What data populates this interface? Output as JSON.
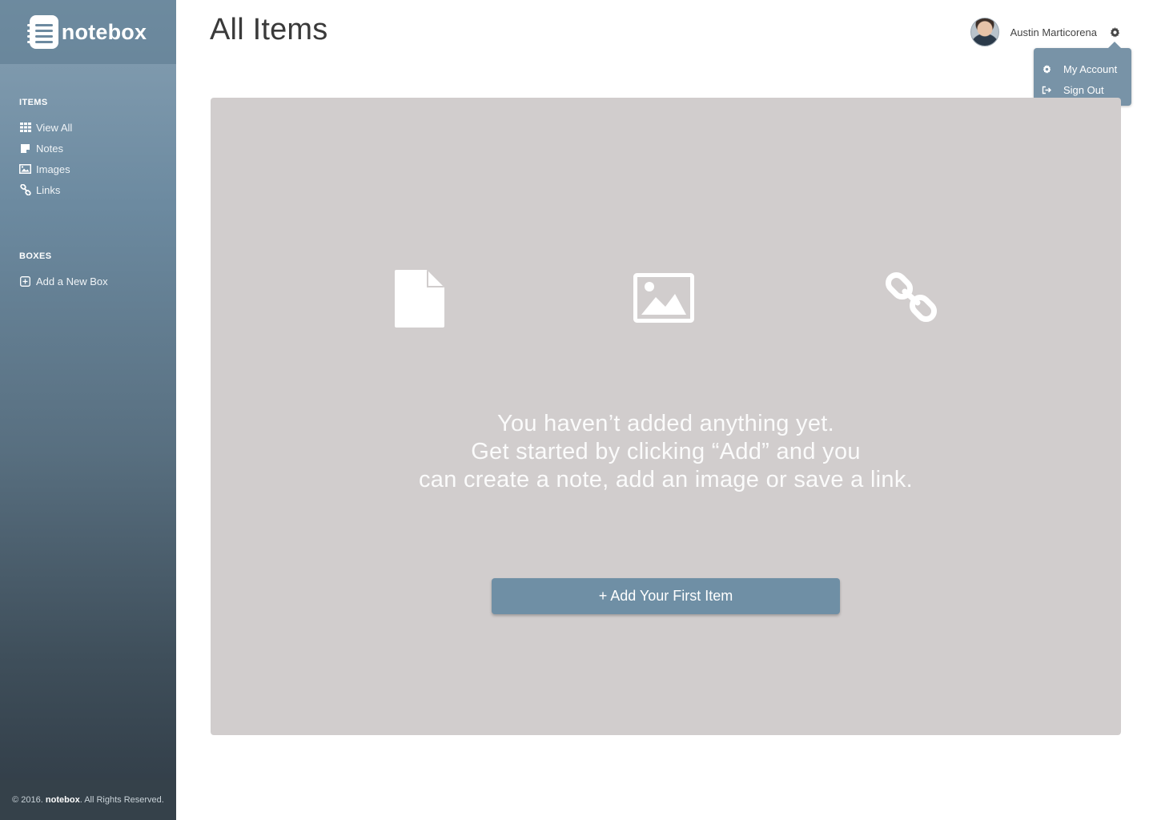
{
  "brand": {
    "name": "notebox"
  },
  "sidebar": {
    "items_heading": "ITEMS",
    "items": [
      {
        "label": "View All",
        "icon": "grid-icon"
      },
      {
        "label": "Notes",
        "icon": "note-icon"
      },
      {
        "label": "Images",
        "icon": "image-icon"
      },
      {
        "label": "Links",
        "icon": "link-icon"
      }
    ],
    "boxes_heading": "BOXES",
    "boxes": [
      {
        "label": "Add a New Box",
        "icon": "plus-square-icon"
      }
    ],
    "footer": {
      "prefix": "© 2016.",
      "brand": "notebox",
      "suffix": ". All Rights Reserved."
    }
  },
  "header": {
    "title": "All Items",
    "user_name": "Austin Marticorena"
  },
  "user_menu": {
    "items": [
      {
        "label": "My Account",
        "icon": "gear-icon"
      },
      {
        "label": "Sign Out",
        "icon": "sign-out-icon"
      }
    ]
  },
  "empty_state": {
    "icons": [
      "document-icon",
      "image-icon",
      "link-icon"
    ],
    "lines": [
      "You haven’t added anything yet.",
      "Get started by clicking “Add” and you",
      "can create a note, add an image or save a link."
    ],
    "button_label": "+ Add Your First Item"
  },
  "colors": {
    "sidebar_top": "#86a0b3",
    "sidebar_bottom": "#303b45",
    "card_bg": "#d1cdcd",
    "accent": "#6f8fa5",
    "dropdown_bg": "#7893a7"
  }
}
